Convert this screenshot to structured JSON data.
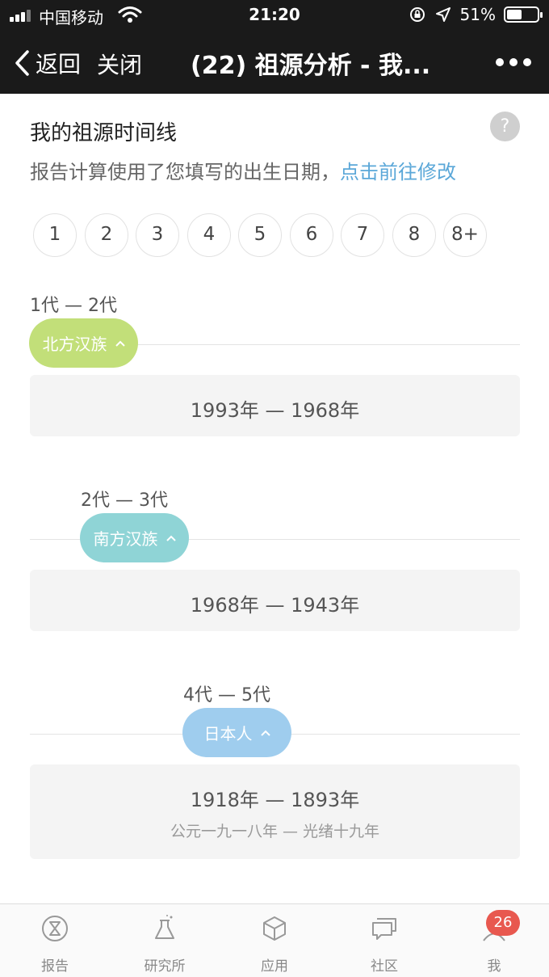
{
  "status_bar": {
    "carrier": "中国移动",
    "time": "21:20",
    "battery_text": "51%",
    "battery_level": 0.51,
    "icons": [
      "signal-icon",
      "wifi-icon",
      "rotation-lock-icon",
      "location-arrow-icon",
      "battery-icon"
    ]
  },
  "nav": {
    "back_label": "返回",
    "close_label": "关闭",
    "title": "(22) 祖源分析 - 我...",
    "more_icon": "more-dots-icon"
  },
  "content": {
    "title": "我的祖源时间线",
    "help_icon": "?",
    "subtitle_prefix": "报告计算使用了您填写的出生日期，",
    "subtitle_link": "点击前往修改",
    "generations": [
      "1",
      "2",
      "3",
      "4",
      "5",
      "6",
      "7",
      "8",
      "8+"
    ],
    "timeline": [
      {
        "range": "1代 — 2代",
        "ancestry": "北方汉族",
        "color": "#c2df79",
        "years": "1993年 — 1968年"
      },
      {
        "range": "2代 — 3代",
        "ancestry": "南方汉族",
        "color": "#8fd4d6",
        "years": "1968年 — 1943年"
      },
      {
        "range": "4代 — 5代",
        "ancestry": "日本人",
        "color": "#9fcdee",
        "years": "1918年 — 1893年",
        "era": "公元一九一八年 — 光绪十九年"
      }
    ]
  },
  "tabbar": {
    "tabs": [
      {
        "label": "报告",
        "icon": "hourglass-icon"
      },
      {
        "label": "研究所",
        "icon": "flask-icon"
      },
      {
        "label": "应用",
        "icon": "cube-icon"
      },
      {
        "label": "社区",
        "icon": "chat-icon"
      },
      {
        "label": "我",
        "icon": "person-icon"
      }
    ],
    "badge": "26"
  },
  "colors": {
    "header_bg": "#1a1a1a",
    "link": "#5aa7d8",
    "card_bg": "#f4f4f4",
    "badge": "#e8584f"
  }
}
